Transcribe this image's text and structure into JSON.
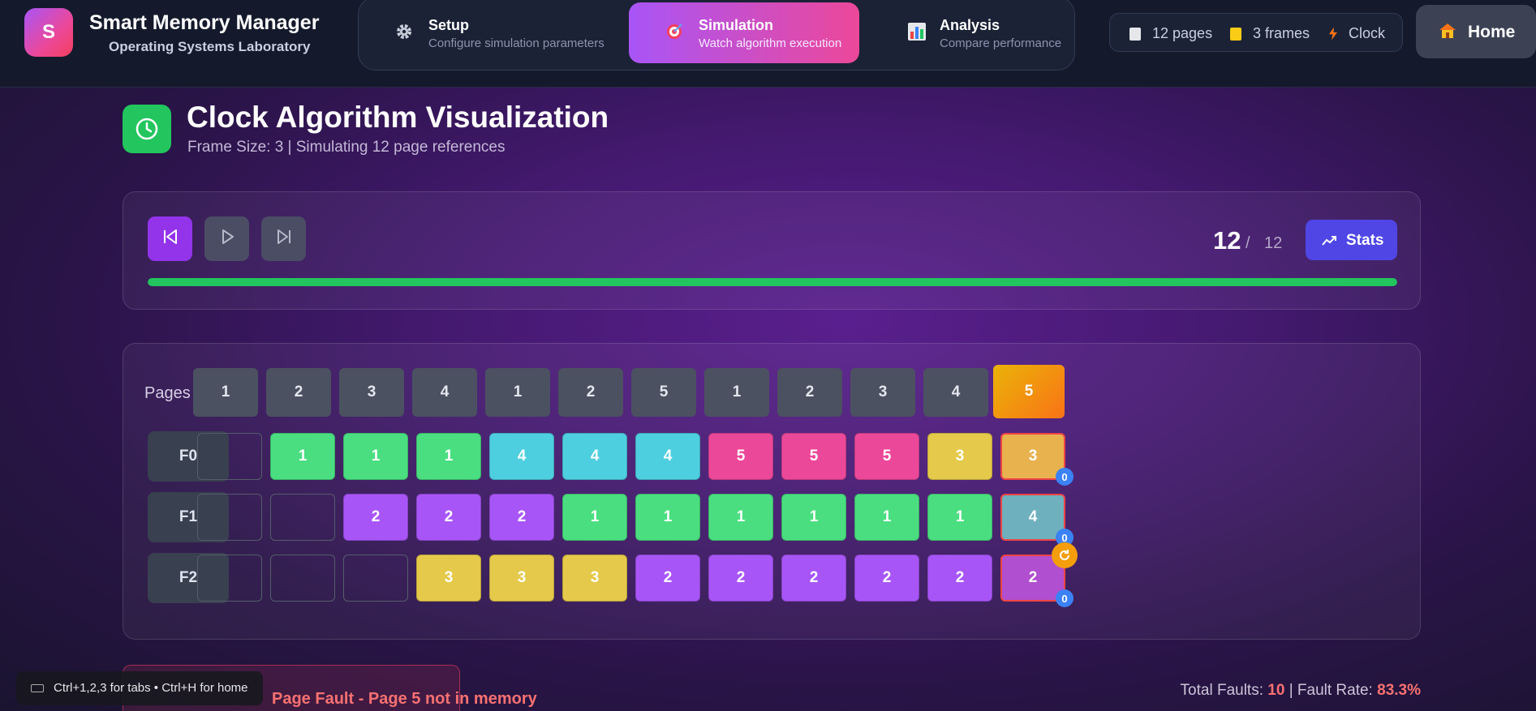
{
  "app": {
    "logo_letter": "S",
    "title": "Smart Memory Manager",
    "subtitle": "Operating Systems Laboratory"
  },
  "nav_tabs": [
    {
      "label": "Setup",
      "description": "Configure simulation parameters",
      "icon": "gear-icon",
      "active": false
    },
    {
      "label": "Simulation",
      "description": "Watch algorithm execution",
      "icon": "target-icon",
      "active": true
    },
    {
      "label": "Analysis",
      "description": "Compare performance",
      "icon": "bar-chart-icon",
      "active": false
    }
  ],
  "info_pill": {
    "pages": "12 pages",
    "frames": "3 frames",
    "algorithm": "Clock"
  },
  "home_button": {
    "label": "Home"
  },
  "header": {
    "title": "Clock Algorithm Visualization",
    "subtitle": "Frame Size: 3 | Simulating 12 page references"
  },
  "controls": {
    "current_step": "12",
    "separator": "/",
    "total_steps": "12",
    "progress": 1.0,
    "stats_label": "Stats"
  },
  "grid": {
    "pages_label": "Pages",
    "reference_string": [
      "1",
      "2",
      "3",
      "4",
      "1",
      "2",
      "5",
      "1",
      "2",
      "3",
      "4",
      "5"
    ],
    "current_index": 11,
    "frame_labels": [
      "F0",
      "F1",
      "F2"
    ],
    "frames": [
      [
        "",
        "1",
        "1",
        "1",
        "4",
        "4",
        "4",
        "5",
        "5",
        "5",
        "3",
        "3"
      ],
      [
        "",
        "",
        "2",
        "2",
        "2",
        "1",
        "1",
        "1",
        "1",
        "1",
        "1",
        "4"
      ],
      [
        "",
        "",
        "",
        "3",
        "3",
        "3",
        "2",
        "2",
        "2",
        "2",
        "2",
        "2"
      ]
    ],
    "current_ref_bits": [
      "0",
      "0",
      "0"
    ],
    "clock_hand_frame": 2,
    "page_colors": {
      "1": "#4ade80",
      "2": "#a855f7",
      "3": "#e5c94a",
      "4": "#4ecfe0",
      "5": "#ec4899"
    },
    "current_column_colors": [
      "#e8b24f",
      "#6fb0be",
      "#b04fcf"
    ]
  },
  "status": {
    "fault_message": "Page Fault - Page 5 not in memory",
    "total_faults_label": "Total Faults:",
    "total_faults": "10",
    "fault_rate_label": "Fault Rate:",
    "fault_rate": "83.3%",
    "separator": "|"
  },
  "shortcut_tip": "Ctrl+1,2,3 for tabs • Ctrl+H for home"
}
